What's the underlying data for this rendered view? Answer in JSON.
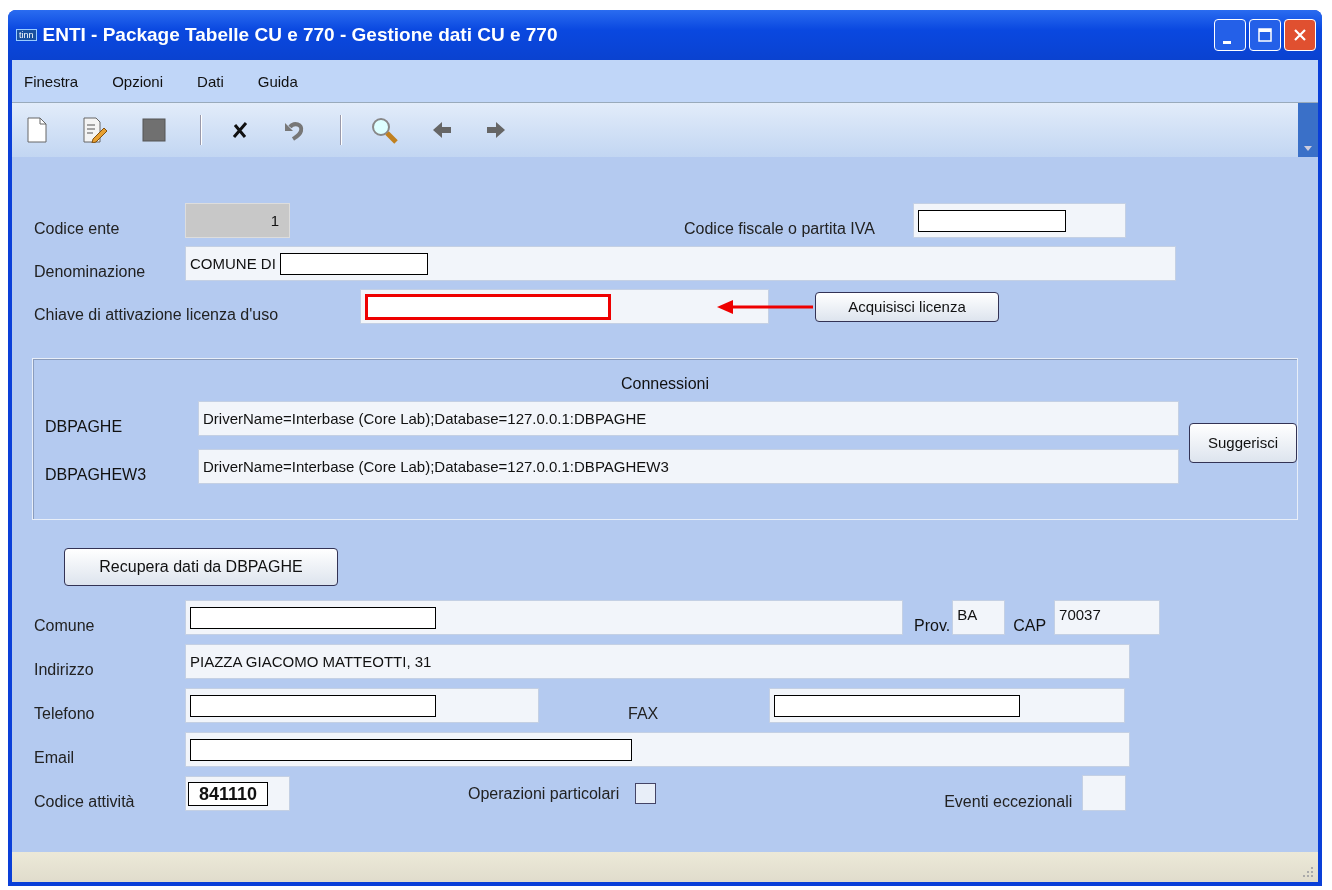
{
  "window": {
    "title": "ENTI - Package Tabelle CU e 770 - Gestione dati CU e 770",
    "app_icon_text": "tinn"
  },
  "menu": [
    "Finestra",
    "Opzioni",
    "Dati",
    "Guida"
  ],
  "toolbar": [
    {
      "kind": "new"
    },
    {
      "kind": "edit"
    },
    {
      "kind": "stop"
    },
    {
      "kind": "sep"
    },
    {
      "kind": "cancel"
    },
    {
      "kind": "undo"
    },
    {
      "kind": "sep"
    },
    {
      "kind": "search"
    },
    {
      "kind": "back"
    },
    {
      "kind": "forward"
    }
  ],
  "top_fields": {
    "codice_ente": {
      "label": "Codice ente",
      "value": "1",
      "disabled": true
    },
    "codice_fiscale": {
      "label": "Codice fiscale o partita IVA",
      "redacted": true
    },
    "denominazione": {
      "label": "Denominazione",
      "value": "COMUNE DI",
      "redacted": true
    },
    "chiave": {
      "label": "Chiave di attivazione licenza d'uso",
      "redacted": true,
      "highlighted": true
    },
    "acquisisci_button": "Acquisisci licenza"
  },
  "connessioni": {
    "title": "Connessioni",
    "rows": [
      {
        "label": "DBPAGHE",
        "value": "DriverName=Interbase (Core Lab);Database=127.0.0.1:DBPAGHE"
      },
      {
        "label": "DBPAGHEW3",
        "value": "DriverName=Interbase (Core Lab);Database=127.0.0.1:DBPAGHEW3"
      }
    ],
    "button": "Suggerisci"
  },
  "recupera_button": "Recupera dati da DBPAGHE",
  "address": {
    "comune": {
      "label": "Comune",
      "redacted": true
    },
    "prov": {
      "label": "Prov.",
      "value": "BA"
    },
    "cap": {
      "label": "CAP",
      "value": "70037"
    },
    "indirizzo": {
      "label": "Indirizzo",
      "value": "PIAZZA GIACOMO MATTEOTTI, 31"
    },
    "telefono": {
      "label": "Telefono",
      "redacted": true
    },
    "fax": {
      "label": "FAX",
      "redacted": true
    },
    "email": {
      "label": "Email",
      "redacted": true
    },
    "codice_attivita": {
      "label": "Codice attività",
      "value": "841110"
    },
    "operazioni": {
      "label": "Operazioni particolari",
      "checked": false
    },
    "eventi": {
      "label": "Eventi eccezionali"
    }
  }
}
